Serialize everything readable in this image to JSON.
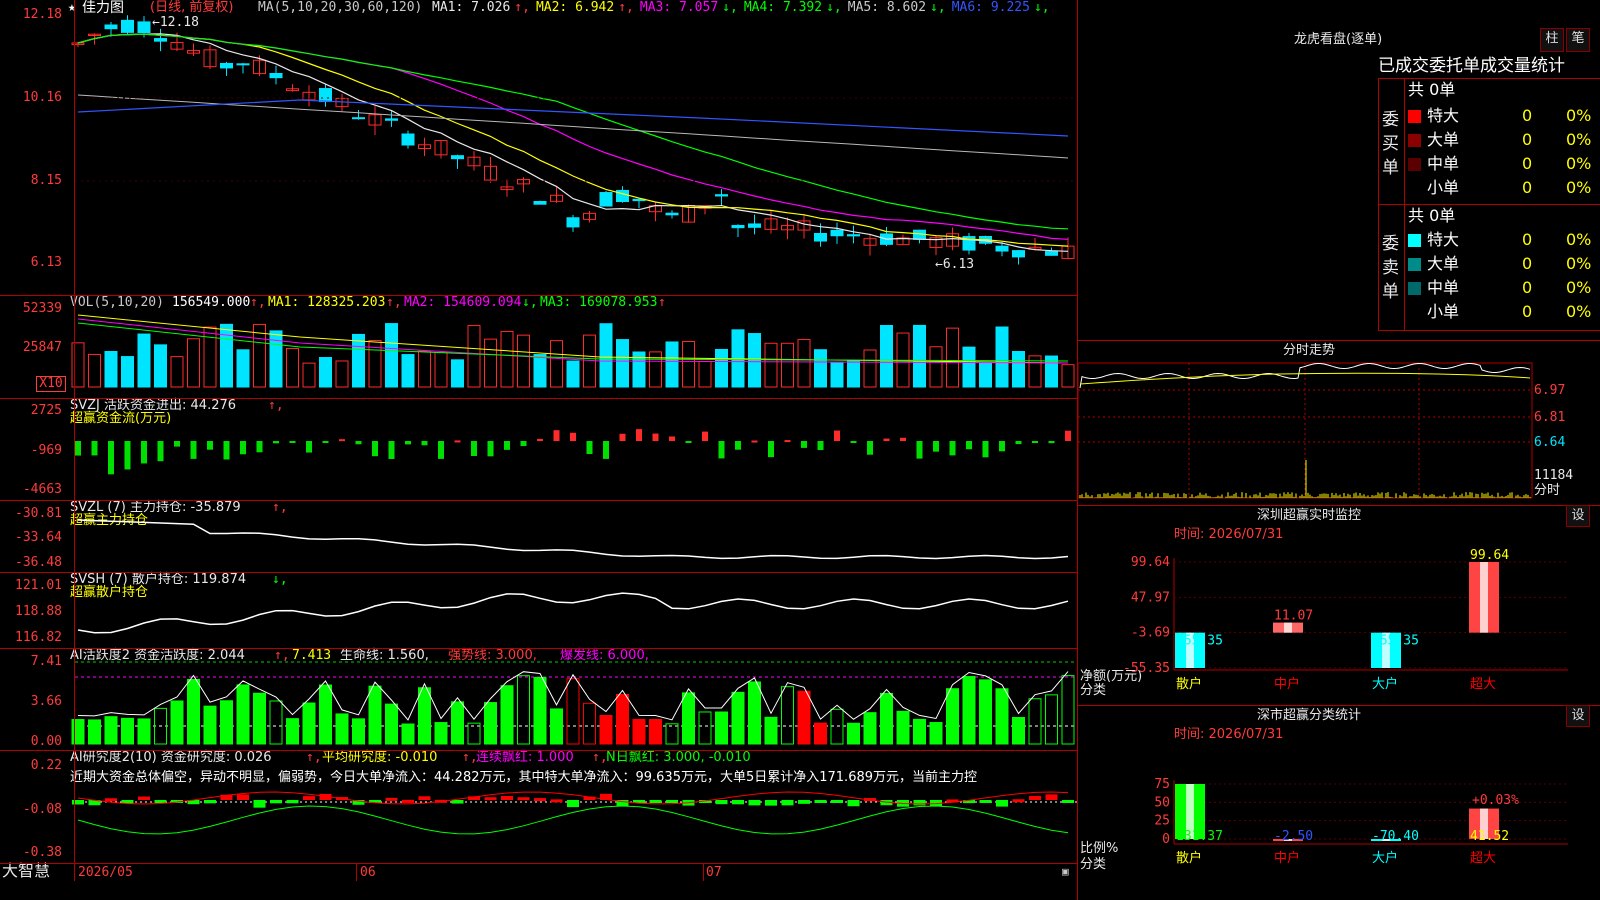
{
  "app_name": "大智慧",
  "main_chart": {
    "title": "佳力图",
    "period": "(日线, 前复权)",
    "ma_params": "MA(5,10,20,30,60,120)",
    "ma_values": [
      {
        "label": "MA1: 7.026",
        "arrow": "↑",
        "color": "#e8e8e8"
      },
      {
        "label": "MA2: 6.942",
        "arrow": "↑",
        "color": "#ffff00"
      },
      {
        "label": "MA3: 7.057",
        "arrow": "↓",
        "color": "#ff00ff"
      },
      {
        "label": "MA4: 7.392",
        "arrow": "↓",
        "color": "#00ff00"
      },
      {
        "label": "MA5: 8.602",
        "arrow": "↓",
        "color": "#c8c8c8"
      },
      {
        "label": "MA6: 9.225",
        "arrow": "↓",
        "color": "#3355ff"
      }
    ],
    "y_ticks": [
      "12.18",
      "10.16",
      "8.15",
      "6.13"
    ],
    "high_label": "12.18",
    "low_label": "6.13"
  },
  "vol_panel": {
    "header": "VOL(5,10,20)",
    "value": "156549.000",
    "ma1": "MA1: 128325.203",
    "ma2": "MA2: 154609.094",
    "ma3": "MA3: 169078.953",
    "y_ticks": [
      "52339",
      "25847"
    ],
    "unit": "X10"
  },
  "svzj_panel": {
    "header": "SVZJ  活跃资金进出: 44.276",
    "subtitle": "超赢资金流(万元)",
    "y_ticks": [
      "2725",
      "-969",
      "-4663"
    ]
  },
  "svzl_panel": {
    "header": "SVZL (7) 主力持仓: -35.879",
    "subtitle": "超赢主力持仓",
    "y_ticks": [
      "-30.81",
      "-33.64",
      "-36.48"
    ]
  },
  "svsh_panel": {
    "header": "SVSH (7) 散户持仓: 119.874",
    "subtitle": "超赢散户持仓",
    "y_ticks": [
      "121.01",
      "118.88",
      "116.82"
    ]
  },
  "ai_active_panel": {
    "header": "AI活跃度2 资金活跃度: 2.044",
    "v2": "7.413",
    "life": "生命线: 1.560,",
    "strong": "强势线: 3.000,",
    "burst": "爆发线: 6.000,",
    "y_ticks": [
      "7.41",
      "3.66",
      "0.00"
    ]
  },
  "ai_research_panel": {
    "header": "AI研究度2(10) 资金研究度: 0.026",
    "avg": "平均研究度: -0.010",
    "red": "连续飘红: 1.000",
    "nred": "N日飘红: 3.000, -0.010",
    "summary": "近期大资金总体偏空，异动不明显，偏弱势，今日大单净流入：44.282万元，其中特大单净流入：99.635万元，大单5日累计净入171.689万元，当前主力控",
    "y_ticks": [
      "0.22",
      "-0.08",
      "-0.38"
    ]
  },
  "x_axis": [
    "2026/05",
    "06",
    "07"
  ],
  "dragon_tiger": {
    "title": "龙虎看盘(逐单)",
    "btn_bar": "柱",
    "btn_order": "笔",
    "subtitle": "已成交委托单成交量统计",
    "buy_label": "委买单",
    "sell_label": "委卖单",
    "buy_total": "共 0单",
    "sell_total": "共 0单",
    "buy_rows": [
      {
        "name": "特大",
        "count": "0",
        "pct": "0%",
        "color": "#ff0000"
      },
      {
        "name": "大单",
        "count": "0",
        "pct": "0%",
        "color": "#8b0000"
      },
      {
        "name": "中单",
        "count": "0",
        "pct": "0%",
        "color": "#5a0000"
      },
      {
        "name": "小单",
        "count": "0",
        "pct": "0%",
        "color": "#000000"
      }
    ],
    "sell_rows": [
      {
        "name": "特大",
        "count": "0",
        "pct": "0%",
        "color": "#00ffff"
      },
      {
        "name": "大单",
        "count": "0",
        "pct": "0%",
        "color": "#008b8b"
      },
      {
        "name": "中单",
        "count": "0",
        "pct": "0%",
        "color": "#006a6a"
      },
      {
        "name": "小单",
        "count": "0",
        "pct": "0%",
        "color": "#000000"
      }
    ]
  },
  "intraday": {
    "title": "分时走势",
    "y_ticks": [
      "6.97",
      "6.81",
      "6.64"
    ],
    "vol_tick": "11184",
    "unit": "分时"
  },
  "monitor": {
    "title": "深圳超赢实时监控",
    "btn": "设",
    "time": "时间: 2026/07/31",
    "y_ticks": [
      "99.64",
      "47.97",
      "-3.69",
      "-55.35"
    ],
    "ylabel": "净额(万元)",
    "xlabel": "分类",
    "categories": [
      "散户",
      "中户",
      "大户",
      "超大"
    ],
    "values": [
      -55.35,
      11.07,
      -55.35,
      99.64
    ],
    "value_labels": [
      "-55.35",
      "11.07",
      "-55.35",
      "99.64"
    ]
  },
  "classify": {
    "title": "深市超赢分类统计",
    "btn": "设",
    "time": "时间: 2026/07/31",
    "y_ticks": [
      "75",
      "50",
      "25",
      "0"
    ],
    "ylabel": "比例%",
    "xlabel": "分类",
    "categories": [
      "散户",
      "中户",
      "大户",
      "超大"
    ],
    "values": [
      131.37,
      -2.5,
      -70.4,
      41.52
    ],
    "value_labels": [
      "131.37",
      "-2.50",
      "-70.40",
      "41.52"
    ],
    "bar_note": "+0.03%"
  },
  "chart_data": [
    {
      "type": "bar",
      "title": "深圳超赢实时监控",
      "categories": [
        "散户",
        "中户",
        "大户",
        "超大"
      ],
      "values": [
        -55.35,
        11.07,
        -55.35,
        99.64
      ],
      "ylabel": "净额(万元)",
      "ylim": [
        -55.35,
        99.64
      ]
    },
    {
      "type": "bar",
      "title": "深市超赢分类统计",
      "categories": [
        "散户",
        "中户",
        "大户",
        "超大"
      ],
      "values": [
        131.37,
        -2.5,
        -70.4,
        41.52
      ],
      "ylabel": "比例%",
      "ylim": [
        0,
        75
      ]
    }
  ],
  "colors": {
    "up": "#ff2a2a",
    "down": "#00e5ff",
    "grid": "#b00000",
    "axis_text": "#ff3b3b"
  }
}
